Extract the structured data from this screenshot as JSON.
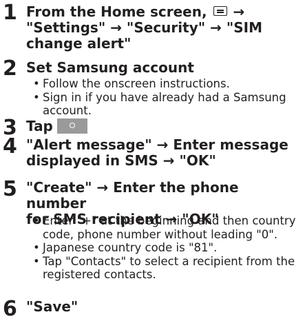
{
  "steps": [
    {
      "number": "1",
      "line1_before_icon": "From the Home screen, ",
      "icon": "menu-key-icon",
      "line1_after_icon": " →",
      "line2": "\"Settings\" → \"Security\" → \"SIM",
      "line3": "change alert\""
    },
    {
      "number": "2",
      "title": "Set Samsung account",
      "bullets": [
        "Follow the onscreen instructions.",
        "Sign in if you have already had a Samsung account."
      ]
    },
    {
      "number": "3",
      "title": "Tap",
      "icon": "toggle-off-icon"
    },
    {
      "number": "4",
      "line1": "\"Alert message\" → Enter message",
      "line2": "displayed in SMS → \"OK\""
    },
    {
      "number": "5",
      "line1": "\"Create\" → Enter the phone number",
      "line2": "for SMS recipient → \"OK\"",
      "bullets": [
        "Enter \"+\" at the beginning and then country code, phone number without leading \"0\".",
        "Japanese country code is \"81\".",
        "Tap \"Contacts\" to select a recipient from the registered contacts."
      ]
    },
    {
      "number": "6",
      "title": "\"Save\""
    }
  ]
}
